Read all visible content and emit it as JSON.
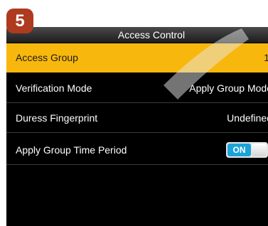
{
  "step_number": "5",
  "title": "Access Control",
  "menu": [
    {
      "label": "Access Group",
      "value": "1"
    },
    {
      "label": "Verification Mode",
      "value": "Apply Group Mode"
    },
    {
      "label": "Duress Fingerprint",
      "value": "Undefined"
    },
    {
      "label": "Apply Group Time Period",
      "toggle": "ON"
    }
  ],
  "colors": {
    "selected_background": "#f8b70c",
    "toggle_on": "#1aa3d8",
    "badge": "#ae3a20",
    "screen_background": "#000000"
  }
}
